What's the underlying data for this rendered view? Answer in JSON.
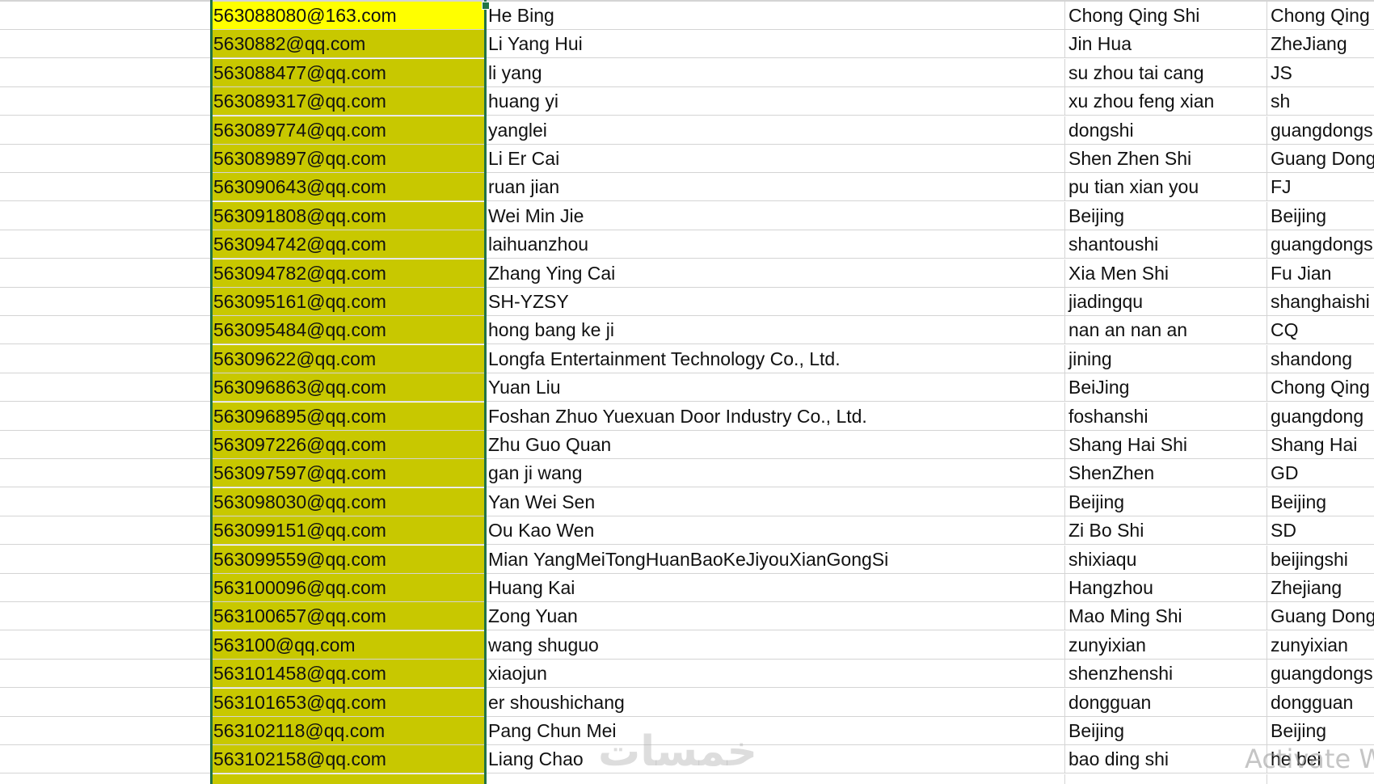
{
  "sheet": {
    "rows": [
      {
        "email": "563088080@163.com",
        "name": "He Bing",
        "city": "Chong Qing Shi",
        "province": "Chong Qing"
      },
      {
        "email": "5630882@qq.com",
        "name": "Li Yang Hui",
        "city": "Jin Hua",
        "province": "ZheJiang"
      },
      {
        "email": "563088477@qq.com",
        "name": "li yang",
        "city": "su zhou tai cang",
        "province": "JS"
      },
      {
        "email": "563089317@qq.com",
        "name": "huang yi",
        "city": "xu zhou feng xian",
        "province": "sh"
      },
      {
        "email": "563089774@qq.com",
        "name": "yanglei",
        "city": "dongshi",
        "province": "guangdongs"
      },
      {
        "email": "563089897@qq.com",
        "name": "Li Er Cai",
        "city": "Shen Zhen Shi",
        "province": "Guang Dong"
      },
      {
        "email": "563090643@qq.com",
        "name": "ruan jian",
        "city": "pu tian xian you",
        "province": "FJ"
      },
      {
        "email": "563091808@qq.com",
        "name": "Wei Min Jie",
        "city": "Beijing",
        "province": "Beijing"
      },
      {
        "email": "563094742@qq.com",
        "name": "laihuanzhou",
        "city": "shantoushi",
        "province": "guangdongs"
      },
      {
        "email": "563094782@qq.com",
        "name": "Zhang Ying Cai",
        "city": "Xia Men Shi",
        "province": "Fu Jian"
      },
      {
        "email": "563095161@qq.com",
        "name": "SH-YZSY",
        "city": "jiadingqu",
        "province": "shanghaishi"
      },
      {
        "email": "563095484@qq.com",
        "name": "hong bang ke ji",
        "city": "nan an nan an",
        "province": "CQ"
      },
      {
        "email": "56309622@qq.com",
        "name": "Longfa Entertainment Technology Co., Ltd.",
        "city": "jining",
        "province": "shandong"
      },
      {
        "email": "563096863@qq.com",
        "name": "Yuan Liu",
        "city": "BeiJing",
        "province": "Chong Qing"
      },
      {
        "email": "563096895@qq.com",
        "name": "Foshan Zhuo Yuexuan Door Industry Co., Ltd.",
        "city": "foshanshi",
        "province": "guangdong"
      },
      {
        "email": "563097226@qq.com",
        "name": "Zhu Guo Quan",
        "city": "Shang Hai Shi",
        "province": "Shang Hai"
      },
      {
        "email": "563097597@qq.com",
        "name": "gan ji wang",
        "city": "ShenZhen",
        "province": "GD"
      },
      {
        "email": "563098030@qq.com",
        "name": "Yan Wei Sen",
        "city": "Beijing",
        "province": "Beijing"
      },
      {
        "email": "563099151@qq.com",
        "name": "Ou Kao Wen",
        "city": "Zi Bo Shi",
        "province": "SD"
      },
      {
        "email": "563099559@qq.com",
        "name": "Mian YangMeiTongHuanBaoKeJiyouXianGongSi",
        "city": "shixiaqu",
        "province": "beijingshi"
      },
      {
        "email": "563100096@qq.com",
        "name": "Huang Kai",
        "city": "Hangzhou",
        "province": "Zhejiang"
      },
      {
        "email": "563100657@qq.com",
        "name": "Zong Yuan",
        "city": "Mao Ming Shi",
        "province": "Guang Dong"
      },
      {
        "email": "563100@qq.com",
        "name": "wang shuguo",
        "city": "zunyixian",
        "province": "zunyixian"
      },
      {
        "email": "563101458@qq.com",
        "name": "xiaojun",
        "city": "shenzhenshi",
        "province": "guangdongs"
      },
      {
        "email": "563101653@qq.com",
        "name": "er shoushichang",
        "city": "dongguan",
        "province": "dongguan"
      },
      {
        "email": "563102118@qq.com",
        "name": "Pang Chun Mei",
        "city": "Beijing",
        "province": "Beijing"
      },
      {
        "email": "563102158@qq.com",
        "name": "Liang Chao",
        "city": "bao ding shi",
        "province": "he bei"
      }
    ]
  },
  "overlays": {
    "watermark": "خمسات",
    "activate_windows": "Activate W"
  }
}
